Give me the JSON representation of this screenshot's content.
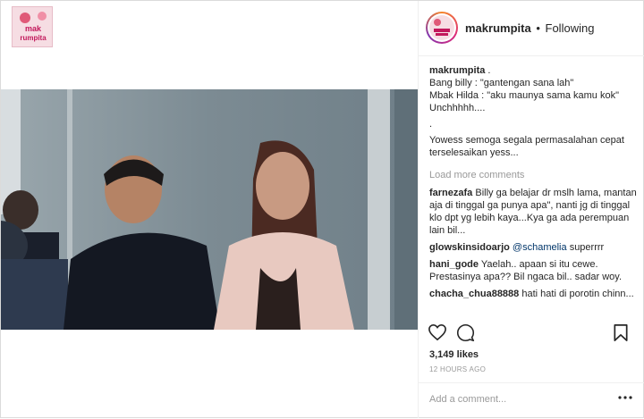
{
  "corner_logo": {
    "text_top": "mak",
    "text_bottom": "rumpita"
  },
  "header": {
    "username": "makrumpita",
    "separator": "•",
    "follow_status": "Following"
  },
  "caption": {
    "username": "makrumpita",
    "lines": [
      ".",
      "Bang billy : \"gantengan sana lah\"",
      "Mbak Hilda : \"aku maunya sama kamu kok\"",
      "Unchhhhh....",
      ".",
      "Yowess semoga segala permasalahan cepat",
      "terselesaikan yess..."
    ]
  },
  "load_more": "Load more comments",
  "comments": [
    {
      "user": "farnezafa",
      "text": "Billy ga belajar dr mslh lama, mantan aja di tinggal ga punya apa\", nanti jg di tinggal klo dpt yg lebih kaya...Kya ga ada perempuan lain bil..."
    },
    {
      "user": "glowskinsidoarjo",
      "mention": "@schamelia",
      "text": "superrrr"
    },
    {
      "user": "hani_gode",
      "text": "Yaelah.. apaan si itu cewe. Prestasinya apa?? Bil ngaca bil.. sadar woy."
    },
    {
      "user": "chacha_chua88888",
      "text": "hati hati di porotin chinn..."
    }
  ],
  "actions": {
    "like_icon": "heart-icon",
    "comment_icon": "comment-icon",
    "save_icon": "bookmark-icon"
  },
  "likes": "3,149 likes",
  "timestamp": "12 HOURS AGO",
  "comment_box": {
    "placeholder": "Add a comment...",
    "more_icon": "more-horizontal-icon"
  },
  "colors": {
    "link": "#003569",
    "muted": "#999999",
    "border": "#dbdbdb"
  }
}
